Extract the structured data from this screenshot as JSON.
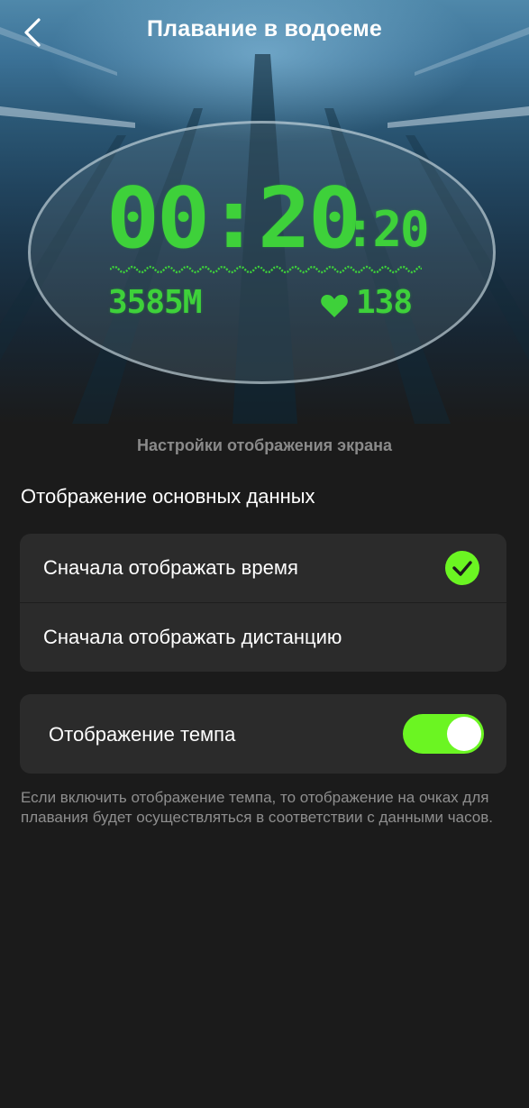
{
  "header": {
    "title": "Плавание в водоеме"
  },
  "preview": {
    "time_main": "00:20",
    "time_seconds": ":20",
    "distance": "3585M",
    "heart_rate": "138",
    "accent_color": "#3ed13a"
  },
  "settings": {
    "section_caption": "Настройки отображения экрана",
    "group_title": "Отображение основных данных",
    "options": [
      {
        "label": "Сначала отображать время",
        "selected": true
      },
      {
        "label": "Сначала отображать дистанцию",
        "selected": false
      }
    ],
    "pace": {
      "label": "Отображение темпа",
      "enabled": true
    },
    "hint": "Если включить отображение темпа, то отображение на очках для плавания будет осуществляться в соответствии с данными часов."
  },
  "colors": {
    "accent": "#6bf522",
    "background": "#1b1b1b",
    "card": "#2b2b2b"
  }
}
